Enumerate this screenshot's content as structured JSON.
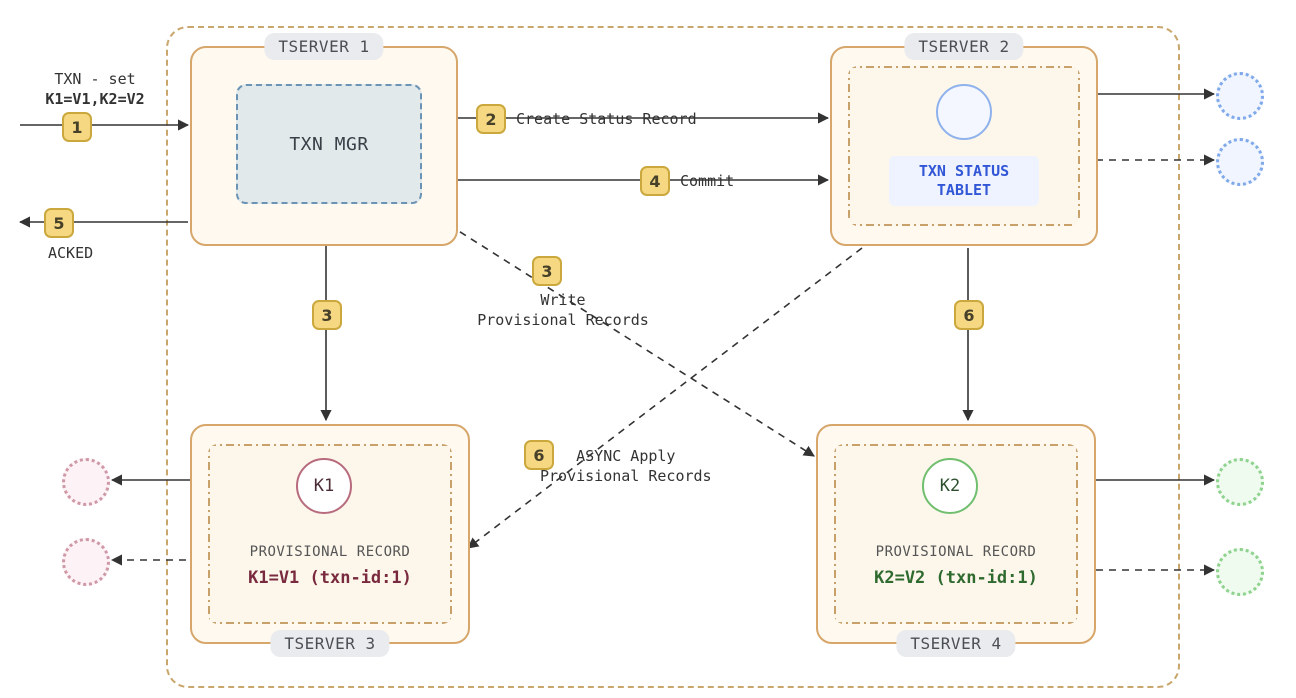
{
  "txn_input": {
    "line1": "TXN - set",
    "line2": "K1=V1,K2=V2"
  },
  "steps": {
    "s1": "1",
    "s2": "2",
    "s3": "3",
    "s4": "4",
    "s5": "5",
    "s6": "6"
  },
  "step_labels": {
    "create_status": "Create Status Record",
    "commit": "Commit",
    "acked": "ACKED",
    "write_prov_head": "Write",
    "write_prov_tail": "Provisional Records",
    "async_apply_head": "ASYNC Apply",
    "async_apply_tail": "Provisional Records"
  },
  "tserver1": {
    "title": "TSERVER 1",
    "txnmgr": "TXN MGR"
  },
  "tserver2": {
    "title": "TSERVER 2",
    "tablet": "TXN STATUS TABLET"
  },
  "tserver3": {
    "title": "TSERVER 3",
    "key": "K1",
    "prov_head": "PROVISIONAL RECORD",
    "prov_val": "K1=V1 (txn-id:1)"
  },
  "tserver4": {
    "title": "TSERVER 4",
    "key": "K2",
    "prov_head": "PROVISIONAL RECORD",
    "prov_val": "K2=V2 (txn-id:1)"
  },
  "colors": {
    "badge_bg": "#f6d883",
    "brand_border": "#d6a66a",
    "k1": "#7a2a3e",
    "k2": "#2f6a2f",
    "blue": "#3156d6"
  }
}
